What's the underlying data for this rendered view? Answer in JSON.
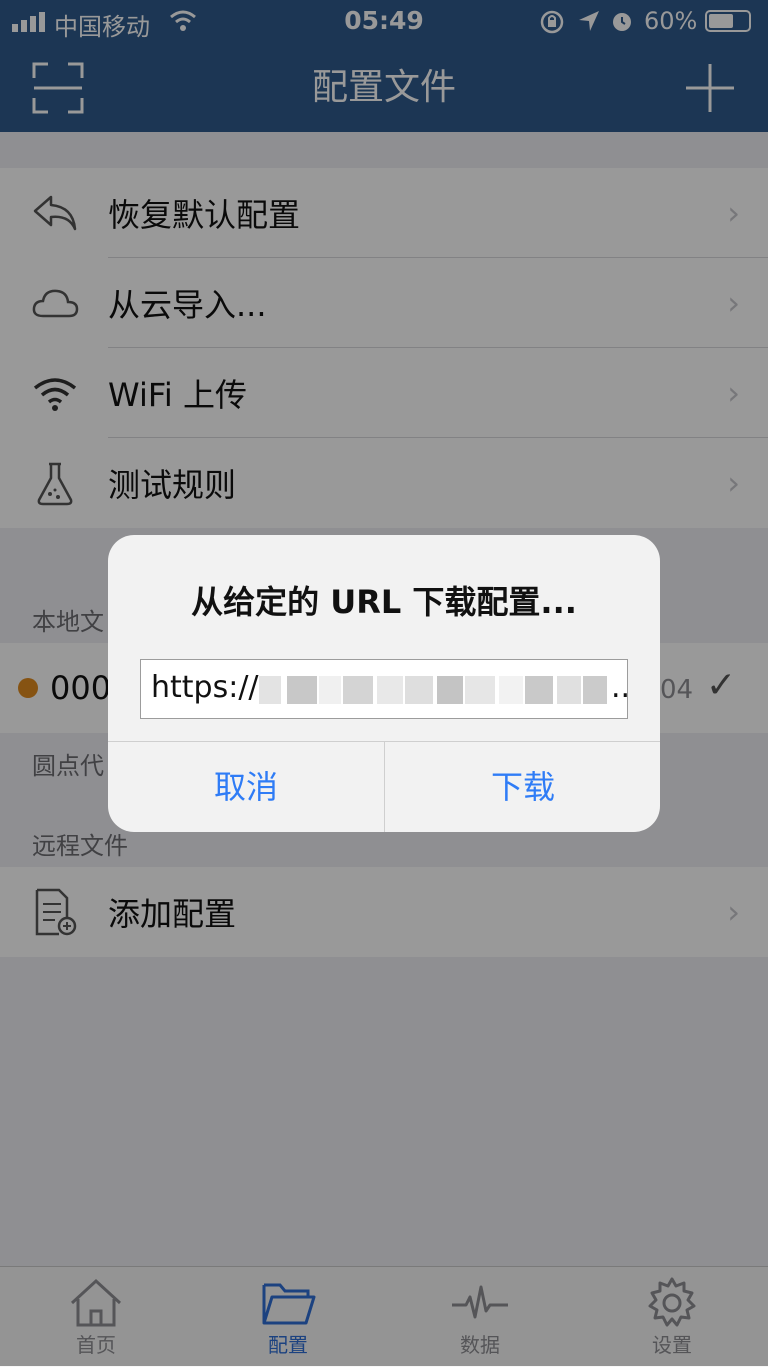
{
  "status_bar": {
    "carrier": "中国移动",
    "time": "05:49",
    "battery": "60%"
  },
  "nav": {
    "title": "配置文件"
  },
  "menu_items": [
    {
      "label": "恢复默认配置",
      "icon": "undo-icon"
    },
    {
      "label": "从云导入...",
      "icon": "cloud-icon"
    },
    {
      "label": "WiFi 上传",
      "icon": "wifi-icon"
    },
    {
      "label": "测试规则",
      "icon": "flask-icon"
    }
  ],
  "local_section": {
    "label": "本地文",
    "item_text": "000",
    "item_right": "04",
    "footer": "圆点代"
  },
  "remote_section": {
    "label": "远程文件",
    "add_label": "添加配置"
  },
  "dialog": {
    "title": "从给定的 URL 下载配置...",
    "input_value": "https://",
    "cancel_label": "取消",
    "download_label": "下载"
  },
  "tabs": [
    {
      "label": "首页",
      "icon": "home-icon",
      "active": false
    },
    {
      "label": "配置",
      "icon": "folder-icon",
      "active": true
    },
    {
      "label": "数据",
      "icon": "pulse-icon",
      "active": false
    },
    {
      "label": "设置",
      "icon": "gear-icon",
      "active": false
    }
  ],
  "colors": {
    "nav_bg": "#2f5a8c",
    "accent": "#2f7cf6",
    "dot": "#e08a1e"
  }
}
